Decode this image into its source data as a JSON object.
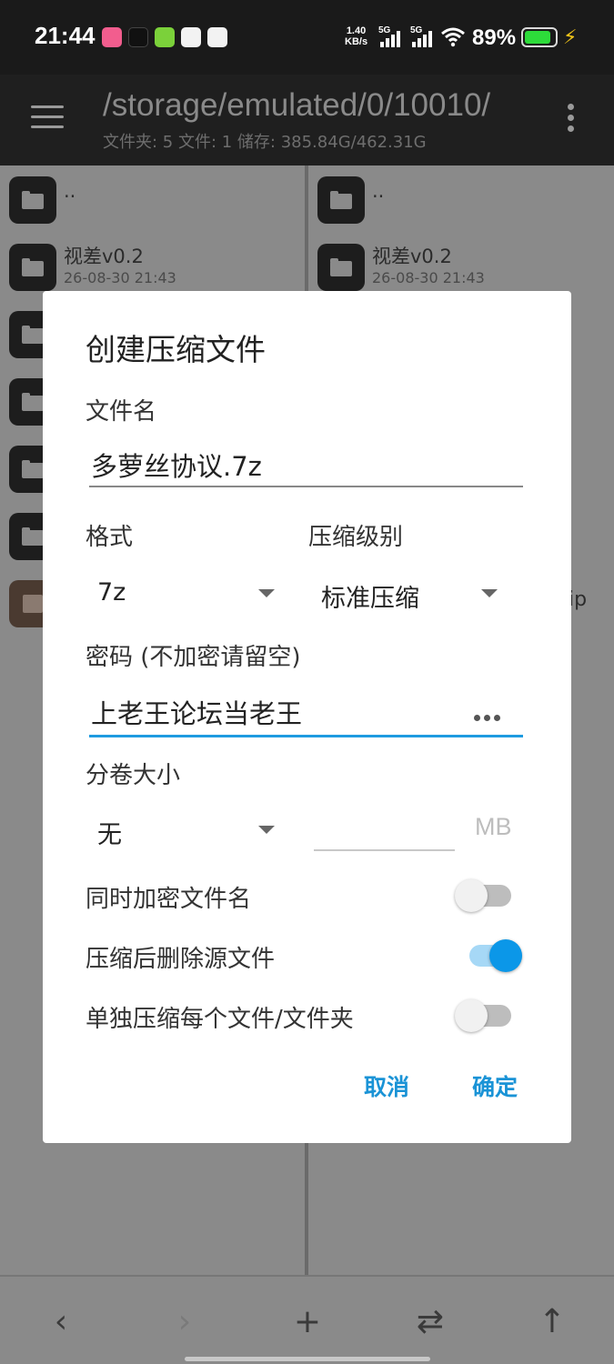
{
  "status_bar": {
    "time": "21:44",
    "net_speed_value": "1.40",
    "net_speed_unit": "KB/s",
    "sim1": "5G",
    "sim2": "5G",
    "battery": "89%",
    "apps": [
      "bilibili-icon",
      "tiktok-icon",
      "kook-icon",
      "app-icon",
      "play-icon"
    ]
  },
  "app_bar": {
    "path": "/storage/emulated/0/10010/",
    "summary": "文件夹: 5  文件: 1  储存: 385.84G/462.31G"
  },
  "left_pane": {
    "parent": "..",
    "item1_name": "视差v0.2",
    "item1_date": "26-08-30 21:43"
  },
  "right_pane": {
    "parent": "..",
    "item1_name": "视差v0.2",
    "item1_date": "26-08-30 21:43",
    "partial_text": "ip"
  },
  "dialog": {
    "title": "创建压缩文件",
    "filename_label": "文件名",
    "filename_value": "多萝丝协议.7z",
    "format_label": "格式",
    "format_value": "7z",
    "level_label": "压缩级别",
    "level_value": "标准压缩",
    "password_label": "密码 (不加密请留空)",
    "password_value": "上老王论坛当老王",
    "split_label": "分卷大小",
    "split_value": "无",
    "split_unit": "MB",
    "encrypt_names_label": "同时加密文件名",
    "encrypt_names_on": false,
    "delete_source_label": "压缩后删除源文件",
    "delete_source_on": true,
    "separate_label": "单独压缩每个文件/文件夹",
    "separate_on": false,
    "cancel": "取消",
    "ok": "确定"
  },
  "bottom_bar": {
    "back": "‹",
    "forward": "›",
    "add": "+",
    "swap": "⇄",
    "up": "↑"
  },
  "colors": {
    "accent": "#1a93d6",
    "toggle_on": "#0b97e8",
    "battery": "#2ddb3a"
  }
}
